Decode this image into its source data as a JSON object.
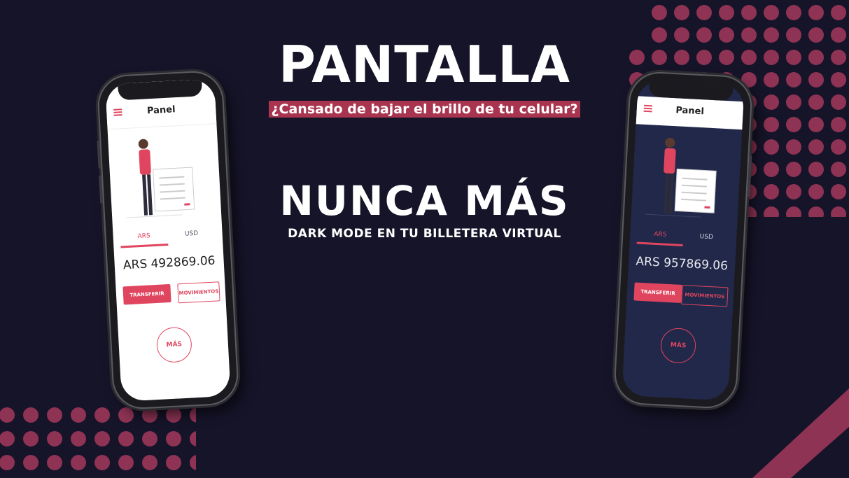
{
  "colors": {
    "background": "#161429",
    "accent": "#e0455f",
    "dots": "#8e3354",
    "dark_screen": "#21284a"
  },
  "headline": {
    "title": "PANTALLA",
    "question": "¿Cansado de bajar el brillo de tu celular?",
    "never": "NUNCA MÁS",
    "subtitle": "DARK MODE EN TU BILLETERA VIRTUAL"
  },
  "phone_light": {
    "panel_title": "Panel",
    "tabs": [
      "ARS",
      "USD"
    ],
    "balance": "ARS 492869.06",
    "transfer_label": "TRANSFERIR",
    "movements_label": "MOVIMIENTOS",
    "more_label": "MÁS",
    "icons": [
      "menu-icon",
      "person-illustration"
    ]
  },
  "phone_dark": {
    "panel_title": "Panel",
    "tabs": [
      "ARS",
      "USD"
    ],
    "balance": "ARS 957869.06",
    "transfer_label": "TRANSFERIR",
    "movements_label": "MOVIMIENTOS",
    "more_label": "MÁS",
    "icons": [
      "menu-icon",
      "person-illustration"
    ]
  }
}
